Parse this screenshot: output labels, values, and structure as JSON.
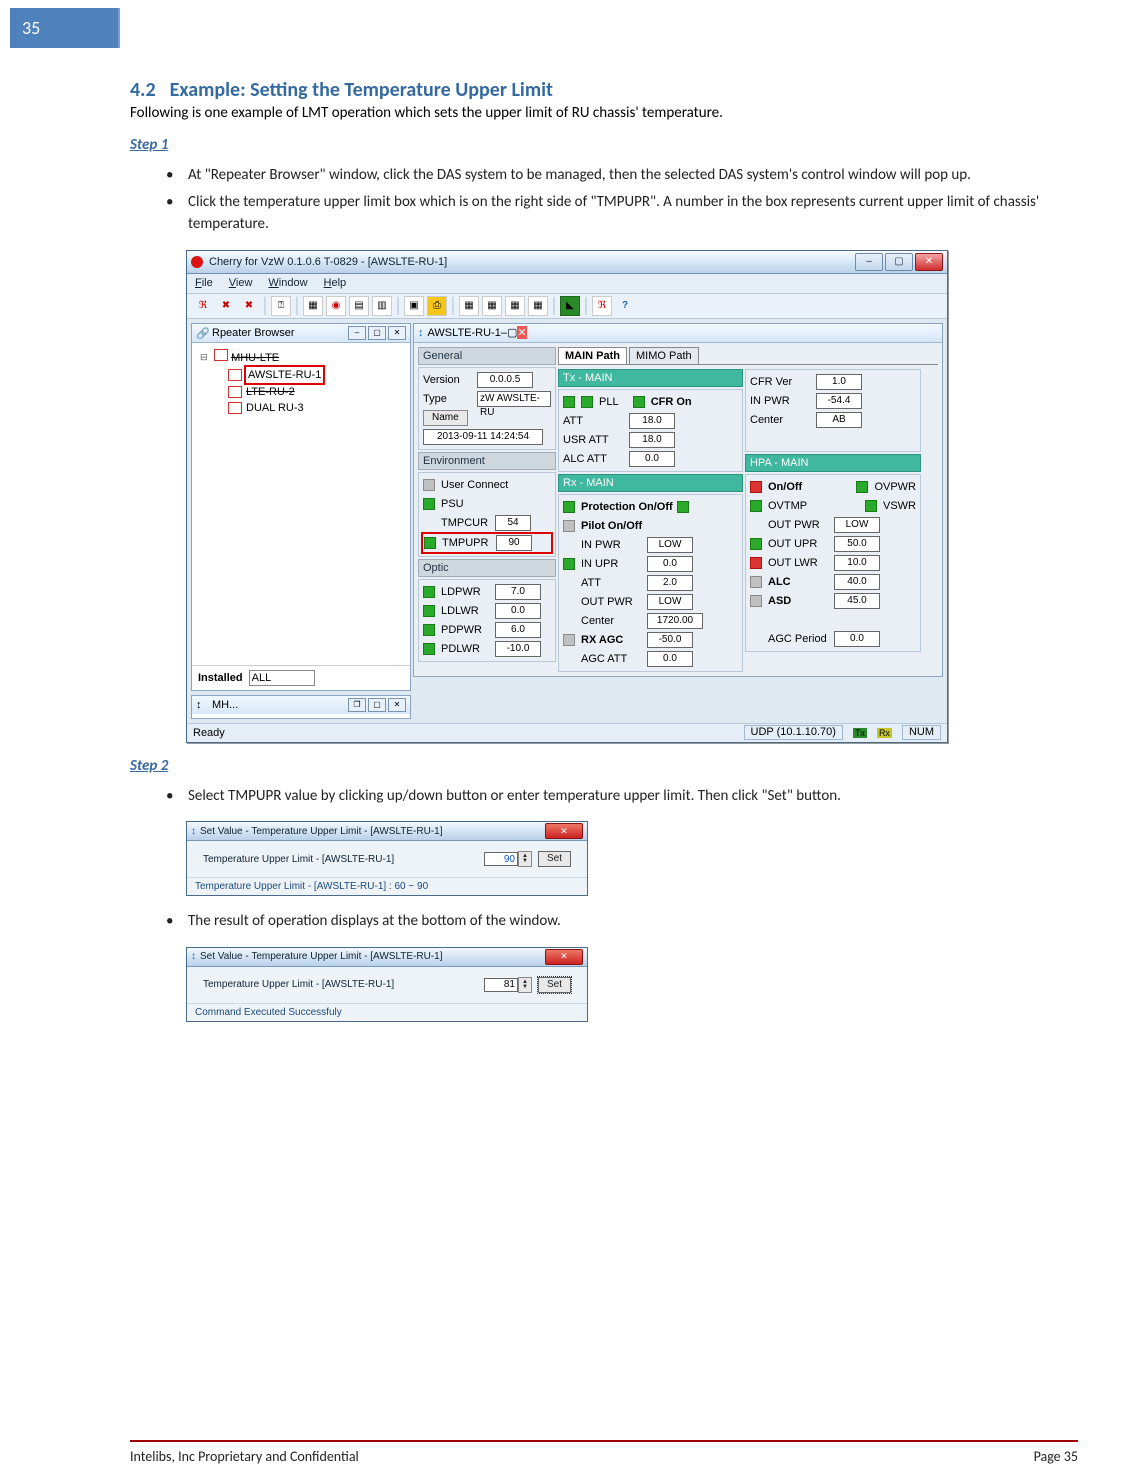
{
  "page_number_box": "35",
  "section": {
    "num": "4.2",
    "title": "Example: Setting the Temperature Upper Limit"
  },
  "intro": "Following is one example of LMT operation which sets the upper limit of RU chassis' temperature.",
  "step1": {
    "heading": "Step 1",
    "bullets": [
      "At \"Repeater Browser\" window, click the DAS system to be managed, then the selected DAS system's control window will pop up.",
      "Click the temperature upper limit box which is on the right side of \"TMPUPR\". A number in the box represents current upper limit of chassis' temperature."
    ]
  },
  "step2": {
    "heading": "Step 2",
    "bullets": [
      "Select TMPUPR value by clicking up/down button or enter temperature upper limit. Then click \"Set\" button.",
      "The result of operation displays at the bottom of the window."
    ]
  },
  "app": {
    "title": "Cherry for VzW 0.1.0.6 T-0829 - [AWSLTE-RU-1]",
    "menu": {
      "file": "File",
      "view": "View",
      "window": "Window",
      "help": "Help"
    },
    "repeater_browser": {
      "title": "Rpeater Browser",
      "root": "MHU-LTE",
      "items": [
        "AWSLTE-RU-1",
        "LTE-RU-2",
        "DUAL RU-3"
      ],
      "installed_label": "Installed",
      "installed_value": "ALL"
    },
    "mh_bar": "MH...",
    "detail": {
      "title": "AWSLTE-RU-1",
      "general": {
        "header": "General",
        "version_lbl": "Version",
        "version": "0.0.0.5",
        "type_lbl": "Type",
        "type": "zW AWSLTE-RU",
        "name_btn": "Name",
        "timestamp": "2013-09-11 14:24:54"
      },
      "env": {
        "header": "Environment",
        "user_connect": "User Connect",
        "psu": "PSU",
        "tmpcur_lbl": "TMPCUR",
        "tmpcur": "54",
        "tmpupr_lbl": "TMPUPR",
        "tmpupr": "90"
      },
      "optic": {
        "header": "Optic",
        "ldpwr_lbl": "LDPWR",
        "ldpwr": "7.0",
        "ldlwr_lbl": "LDLWR",
        "ldlwr": "0.0",
        "pdpwr_lbl": "PDPWR",
        "pdpwr": "6.0",
        "pdlwr_lbl": "PDLWR",
        "pdlwr": "-10.0"
      },
      "tabs": {
        "main": "MAIN Path",
        "mimo": "MIMO Path"
      },
      "tx": {
        "header": "Tx - MAIN",
        "pll": "PLL",
        "cfr_on": "CFR On",
        "cfr_ver_lbl": "CFR Ver",
        "cfr_ver": "1.0",
        "att_lbl": "ATT",
        "att": "18.0",
        "in_pwr_lbl": "IN PWR",
        "in_pwr": "-54.4",
        "usr_att_lbl": "USR ATT",
        "usr_att": "18.0",
        "center_lbl": "Center",
        "center": "AB",
        "alc_att_lbl": "ALC ATT",
        "alc_att": "0.0"
      },
      "rx": {
        "header": "Rx - MAIN",
        "prot": "Protection On/Off",
        "pilot": "Pilot On/Off",
        "in_pwr_lbl": "IN PWR",
        "in_pwr": "LOW",
        "in_upr_lbl": "IN UPR",
        "in_upr": "0.0",
        "att_lbl": "ATT",
        "att": "2.0",
        "out_pwr_lbl": "OUT PWR",
        "out_pwr": "LOW",
        "center_lbl": "Center",
        "center": "1720.00",
        "rx_agc_lbl": "RX AGC",
        "rx_agc": "-50.0",
        "agc_att_lbl": "AGC ATT",
        "agc_att": "0.0"
      },
      "hpa": {
        "header": "HPA - MAIN",
        "onoff": "On/Off",
        "ovpwr": "OVPWR",
        "ovtmp": "OVTMP",
        "vswr": "VSWR",
        "out_pwr_lbl": "OUT PWR",
        "out_pwr": "LOW",
        "out_upr_lbl": "OUT UPR",
        "out_upr": "50.0",
        "out_lwr_lbl": "OUT LWR",
        "out_lwr": "10.0",
        "alc_lbl": "ALC",
        "alc": "40.0",
        "asd_lbl": "ASD",
        "asd": "45.0",
        "agc_period_lbl": "AGC Period",
        "agc_period": "0.0"
      }
    },
    "status": {
      "ready": "Ready",
      "udp": "UDP (10.1.10.70)",
      "tx": "Tx",
      "rx": "Rx",
      "num": "NUM"
    }
  },
  "dlg1": {
    "title": "Set Value - Temperature Upper Limit - [AWSLTE-RU-1]",
    "label": "Temperature Upper Limit - [AWSLTE-RU-1]",
    "value": "90",
    "set": "Set",
    "footer": "Temperature Upper Limit - [AWSLTE-RU-1] : 60 ~ 90"
  },
  "dlg2": {
    "title": "Set Value - Temperature Upper Limit - [AWSLTE-RU-1]",
    "label": "Temperature Upper Limit - [AWSLTE-RU-1]",
    "value": "81",
    "set": "Set",
    "footer": "Command Executed Successfuly"
  },
  "footer": {
    "left": "Intelibs, Inc Proprietary and Confidential",
    "right": "Page 35"
  }
}
